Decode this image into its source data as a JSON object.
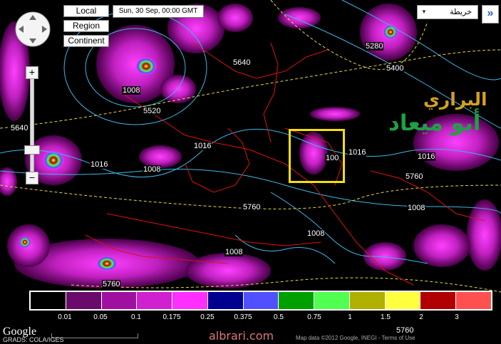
{
  "buttons": {
    "local": "Local",
    "region": "Region",
    "continent": "Continent"
  },
  "date": "Sun, 30 Sep, 00:00 GMT",
  "map_type": {
    "selected": "خريطة",
    "expand": "»"
  },
  "zoom": {
    "plus": "+",
    "minus": "−"
  },
  "brand": {
    "line1": "البراري",
    "line2": "أبو ميعاد"
  },
  "contours": [
    "5640",
    "1008",
    "5520",
    "5640",
    "1016",
    "1008",
    "5760",
    "1016",
    "5280",
    "5400",
    "1016",
    "100",
    "1016",
    "5760",
    "1008",
    "1008",
    "1008",
    "5760",
    "5760"
  ],
  "legend": {
    "colors": [
      "#000000",
      "#6a0a6a",
      "#a010a0",
      "#d020d0",
      "#ff30ff",
      "#000090",
      "#5050ff",
      "#00a000",
      "#50ff50",
      "#b0b000",
      "#ffff40",
      "#b00000",
      "#ff5050"
    ],
    "ticks": [
      "0.01",
      "0.05",
      "0.1",
      "0.175",
      "0.25",
      "0.375",
      "0.5",
      "0.75",
      "1",
      "1.5",
      "2",
      "3"
    ]
  },
  "footer": {
    "google": "Google",
    "grads": "GRADS: COLA/IGES",
    "watermark": "albrari.com",
    "attribution": "Map data ©2012 Google, INEGI - Terms of Use"
  }
}
